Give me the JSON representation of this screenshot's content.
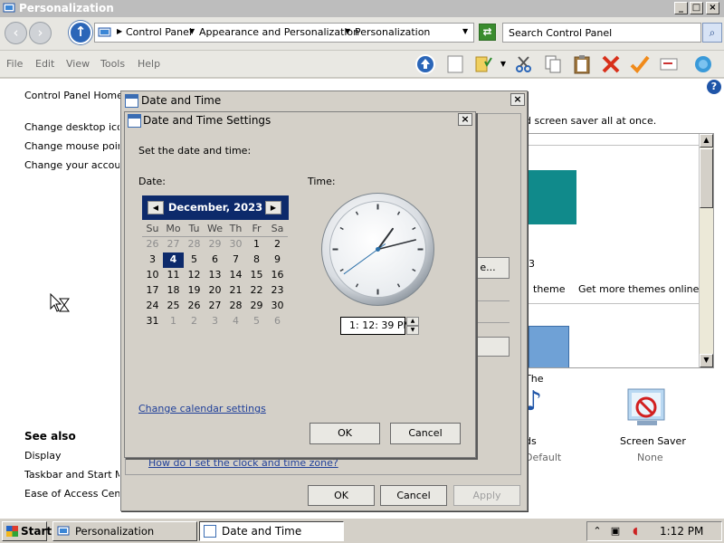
{
  "window": {
    "title": "Personalization",
    "buttons": [
      "_",
      "□",
      "×"
    ]
  },
  "address": {
    "crumbs": [
      "Control Panel",
      "Appearance and Personalization",
      "Personalization"
    ],
    "search_placeholder": "Search Control Panel"
  },
  "menu": [
    "File",
    "Edit",
    "View",
    "Tools",
    "Help"
  ],
  "left_nav": {
    "home": "Control Panel Home",
    "links": [
      "Change desktop icons",
      "Change mouse pointers",
      "Change your account picture"
    ],
    "see_also_title": "See also",
    "see_also": [
      "Display",
      "Taskbar and Start Menu",
      "Ease of Access Center"
    ]
  },
  "main": {
    "intro_text": "d screen saver all at once.",
    "theme_number": "3",
    "theme_link": "theme",
    "more_themes": "Get more themes online",
    "the_text": "The",
    "sounds_label": "ds",
    "sounds_sub": "Default",
    "screen_saver_label": "Screen Saver",
    "screen_saver_sub": "None",
    "button_partial": "e..."
  },
  "outer_dialog": {
    "title": "Date and Time",
    "help_link": "How do I set the clock and time zone?",
    "ok": "OK",
    "cancel": "Cancel",
    "apply": "Apply"
  },
  "settings_dialog": {
    "title": "Date and Time Settings",
    "subtitle": "Set the date and time:",
    "date_label": "Date:",
    "time_label": "Time:",
    "month_year": "December, 2023",
    "weekdays": [
      "Su",
      "Mo",
      "Tu",
      "We",
      "Th",
      "Fr",
      "Sa"
    ],
    "weeks": [
      [
        "26",
        "27",
        "28",
        "29",
        "30",
        "1",
        "2"
      ],
      [
        "3",
        "4",
        "5",
        "6",
        "7",
        "8",
        "9"
      ],
      [
        "10",
        "11",
        "12",
        "13",
        "14",
        "15",
        "16"
      ],
      [
        "17",
        "18",
        "19",
        "20",
        "21",
        "22",
        "23"
      ],
      [
        "24",
        "25",
        "26",
        "27",
        "28",
        "29",
        "30"
      ],
      [
        "31",
        "1",
        "2",
        "3",
        "4",
        "5",
        "6"
      ]
    ],
    "selected_day": "4",
    "time_value": "1: 12: 39 PM",
    "clock": {
      "hour": 1,
      "minute": 12,
      "second": 39
    },
    "calendar_settings_link": "Change calendar settings",
    "ok": "OK",
    "cancel": "Cancel"
  },
  "taskbar": {
    "start": "Start",
    "items": [
      "Personalization",
      "Date and Time"
    ],
    "clock": "1:12 PM"
  },
  "colors": {
    "calendar_header": "#0d2a6b",
    "link": "#1f3f99",
    "theme_swatch": "#108a8b"
  }
}
